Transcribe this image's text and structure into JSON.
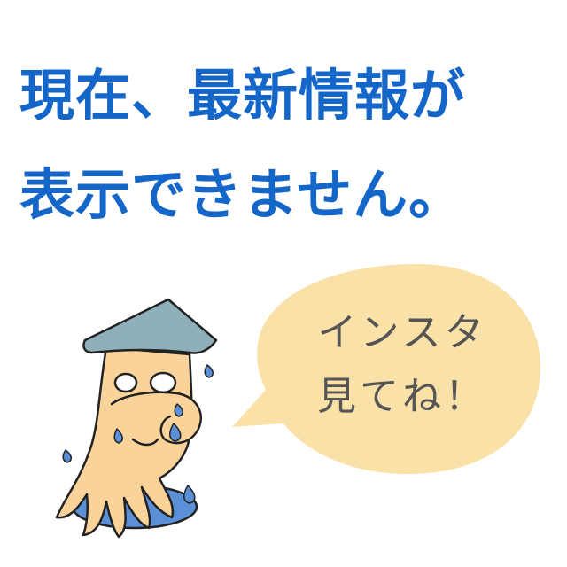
{
  "headline": {
    "line1": "現在、最新情報が",
    "line2": "表示できません。",
    "color": "#1466c8"
  },
  "bubble": {
    "line1": "インスタ",
    "line2": "見てね！",
    "fill": "#fae1a8",
    "text_color": "#555555"
  },
  "character": {
    "hat_color": "#8fb0bb",
    "skin_color": "#fad39a",
    "puddle_color": "#5b8fd6",
    "tear_color": "#5b8fd6"
  }
}
